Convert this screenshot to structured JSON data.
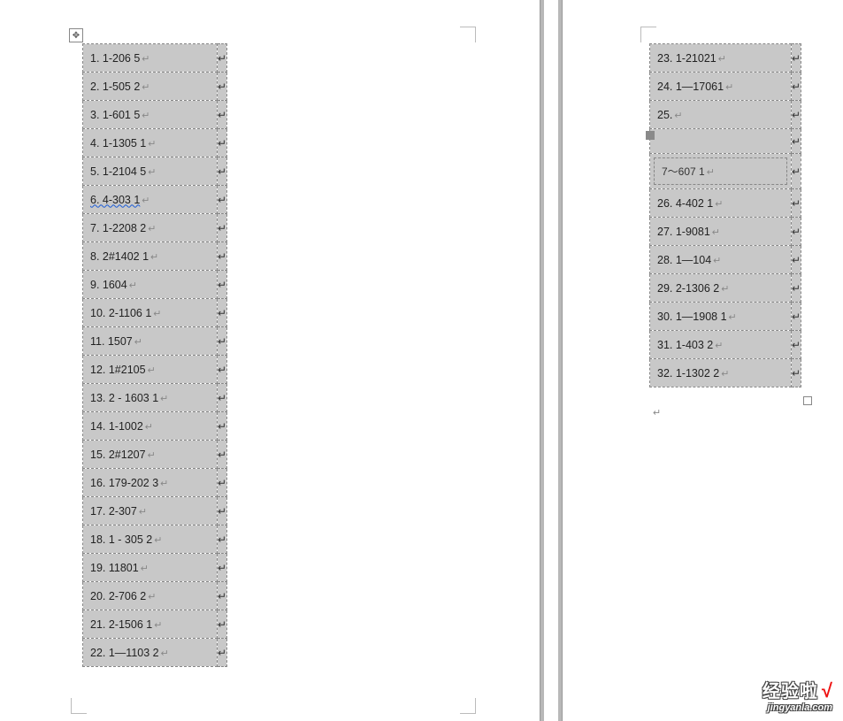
{
  "left_table": {
    "rows": [
      {
        "text": "1. 1-206 5",
        "wavy": false
      },
      {
        "text": "2. 1-505 2",
        "wavy": false
      },
      {
        "text": "3. 1-601 5",
        "wavy": false
      },
      {
        "text": "4. 1-1305 1",
        "wavy": false
      },
      {
        "text": "5. 1-2104 5",
        "wavy": false
      },
      {
        "text": "6. 4-303   1",
        "wavy": true
      },
      {
        "text": "7. 1-2208 2",
        "wavy": false
      },
      {
        "text": "8. 2#1402 1",
        "wavy": false
      },
      {
        "text": "9. 1604 ",
        "wavy": false
      },
      {
        "text": "10. 2-1106 1",
        "wavy": false
      },
      {
        "text": "11. 1507 ",
        "wavy": false
      },
      {
        "text": "12. 1#2105 ",
        "wavy": false
      },
      {
        "text": "13. 2 - 1603 1",
        "wavy": false
      },
      {
        "text": "14. 1-1002 ",
        "wavy": false
      },
      {
        "text": "15. 2#1207 ",
        "wavy": false
      },
      {
        "text": "16. 179-202 3",
        "wavy": false
      },
      {
        "text": "17. 2-307   ",
        "wavy": false
      },
      {
        "text": "18. 1 - 305 2",
        "wavy": false
      },
      {
        "text": "19. 11801 ",
        "wavy": false
      },
      {
        "text": "20. 2-706 2",
        "wavy": false
      },
      {
        "text": "21. 2-1506 1",
        "wavy": false
      },
      {
        "text": "22. 1—1103 2",
        "wavy": false
      }
    ]
  },
  "right_table": {
    "rows_top": [
      {
        "text": "23. 1-21021"
      },
      {
        "text": "24. 1—17061"
      },
      {
        "text": "25. "
      }
    ],
    "inner_cell": {
      "text": "7～607 1"
    },
    "rows_bottom": [
      {
        "text": "26. 4-402 1"
      },
      {
        "text": "27. 1-9081"
      },
      {
        "text": "28. 1—104 "
      },
      {
        "text": "29. 2-1306 2"
      },
      {
        "text": "30. 1—1908 1"
      },
      {
        "text": "31. 1-403 2"
      },
      {
        "text": "32. 1-1302 2"
      }
    ]
  },
  "watermark": {
    "title": "经验啦",
    "check": "√",
    "subtitle": "jingyanla.com"
  },
  "glyphs": {
    "paragraph": "↵",
    "move": "✥"
  }
}
